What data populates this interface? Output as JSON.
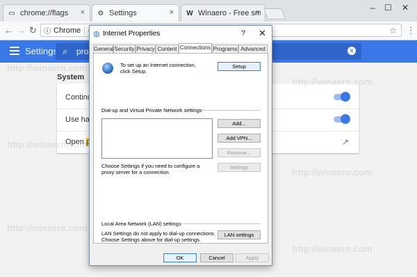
{
  "browser": {
    "tabs": [
      {
        "label": "chrome://flags",
        "icon": "page-icon"
      },
      {
        "label": "Settings",
        "icon": "gear-icon"
      },
      {
        "label": "Winaero - Free small and",
        "icon": "winaero-w-icon"
      }
    ],
    "omnibox": {
      "chip": "Chrome",
      "text": "ch"
    },
    "close_glyph": "×",
    "new_tab": "",
    "window_buttons": {
      "minimize": "–",
      "maximize": "☐",
      "close": "✕"
    },
    "nav": {
      "back": "←",
      "forward": "→",
      "reload": "↻"
    },
    "star": "☆",
    "menu": "⋮"
  },
  "settings": {
    "title": "Settings",
    "search_value": "prox",
    "section_label": "System",
    "rows": [
      {
        "label": "Continue",
        "control": "toggle",
        "state": "on"
      },
      {
        "label": "Use hard",
        "control": "toggle",
        "state": "on"
      },
      {
        "label_pre": "Open ",
        "label_hl": "prox",
        "control": "external-link"
      }
    ]
  },
  "dialog": {
    "title": "Internet Properties",
    "help": "?",
    "close": "✕",
    "tabs": [
      "General",
      "Security",
      "Privacy",
      "Content",
      "Connections",
      "Programs",
      "Advanced"
    ],
    "active_tab": "Connections",
    "setup_text": "To set up an Internet connection, click Setup.",
    "setup_button": "Setup",
    "dialup_group": "Dial-up and Virtual Private Network settings",
    "add_button": "Add...",
    "add_vpn_button": "Add VPN...",
    "remove_button": "Remove...",
    "settings_button": "Settings",
    "proxy_text": "Choose Settings if you need to configure a proxy server for a connection.",
    "lan_group": "Local Area Network (LAN) settings",
    "lan_text": "LAN Settings do not apply to dial-up connections. Choose Settings above for dial-up settings.",
    "lan_button": "LAN settings",
    "ok_button": "OK",
    "cancel_button": "Cancel",
    "apply_button": "Apply"
  },
  "watermark": "http://winaero.com"
}
